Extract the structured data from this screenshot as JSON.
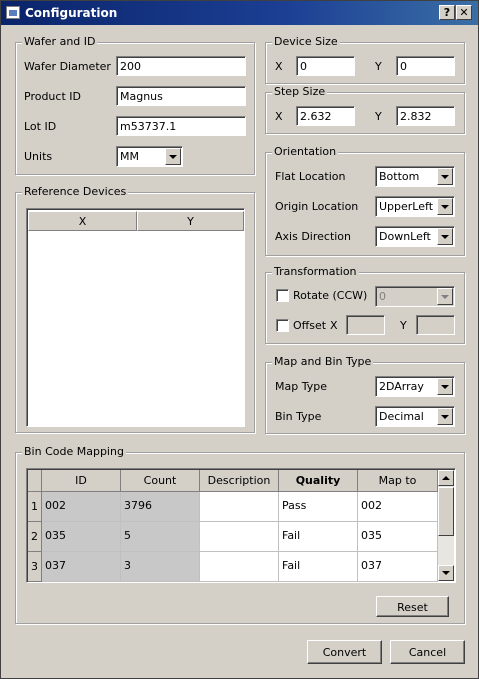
{
  "window": {
    "title": "Configuration",
    "help_button": "?",
    "close_button": "✕"
  },
  "wafer_id": {
    "title": "Wafer and ID",
    "wafer_diameter_label": "Wafer Diameter",
    "wafer_diameter_value": "200",
    "product_id_label": "Product ID",
    "product_id_value": "Magnus",
    "lot_id_label": "Lot ID",
    "lot_id_value": "m53737.1",
    "units_label": "Units",
    "units_value": "MM"
  },
  "device_size": {
    "title": "Device Size",
    "x_label": "X",
    "x_value": "0",
    "y_label": "Y",
    "y_value": "0"
  },
  "step_size": {
    "title": "Step Size",
    "x_label": "X",
    "x_value": "2.632",
    "y_label": "Y",
    "y_value": "2.832"
  },
  "orientation": {
    "title": "Orientation",
    "flat_location_label": "Flat Location",
    "flat_location_value": "Bottom",
    "origin_location_label": "Origin Location",
    "origin_location_value": "UpperLeft",
    "axis_direction_label": "Axis Direction",
    "axis_direction_value": "DownLeft"
  },
  "reference_devices": {
    "title": "Reference Devices",
    "columns": [
      "X",
      "Y"
    ]
  },
  "transformation": {
    "title": "Transformation",
    "rotate_label": "Rotate (CCW)",
    "rotate_checked": false,
    "rotate_value": "0",
    "offset_label": "Offset",
    "offset_checked": false,
    "offset_x_label": "X",
    "offset_x_value": "",
    "offset_y_label": "Y",
    "offset_y_value": ""
  },
  "map_bin_type": {
    "title": "Map and Bin Type",
    "map_type_label": "Map Type",
    "map_type_value": "2DArray",
    "bin_type_label": "Bin Type",
    "bin_type_value": "Decimal"
  },
  "bin_code_mapping": {
    "title": "Bin Code Mapping",
    "columns": [
      "ID",
      "Count",
      "Description",
      "Quality",
      "Map to"
    ],
    "rows": [
      {
        "num": "1",
        "id": "002",
        "count": "3796",
        "description": "",
        "quality": "Pass",
        "map_to": "002"
      },
      {
        "num": "2",
        "id": "035",
        "count": "5",
        "description": "",
        "quality": "Fail",
        "map_to": "035"
      },
      {
        "num": "3",
        "id": "037",
        "count": "3",
        "description": "",
        "quality": "Fail",
        "map_to": "037"
      }
    ],
    "reset_label": "Reset"
  },
  "footer": {
    "convert_label": "Convert",
    "cancel_label": "Cancel"
  },
  "colors": {
    "titlebar_start": "#0a246a",
    "titlebar_end": "#3a6ea5",
    "dialog_bg": "#d4d0c8"
  }
}
